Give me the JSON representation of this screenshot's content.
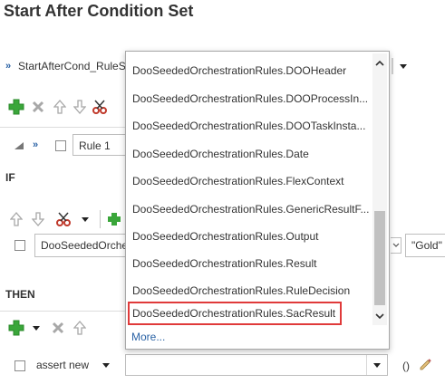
{
  "page": {
    "title": "Start After Condition Set"
  },
  "rule_set": {
    "name": "StartAfterCond_RuleS"
  },
  "rule": {
    "label": "Rule 1"
  },
  "sections": {
    "if_label": "IF",
    "then_label": "THEN"
  },
  "condition": {
    "left_value": "DooSeededOrche",
    "right_value": "\"Gold\""
  },
  "action": {
    "label": "assert new",
    "parens": "()"
  },
  "dropdown": {
    "options": [
      "DooSeededOrchestrationRules.DOOHeader",
      "DooSeededOrchestrationRules.DOOProcessIn...",
      "DooSeededOrchestrationRules.DOOTaskInsta...",
      "DooSeededOrchestrationRules.Date",
      "DooSeededOrchestrationRules.FlexContext",
      "DooSeededOrchestrationRules.GenericResultF...",
      "DooSeededOrchestrationRules.Output",
      "DooSeededOrchestrationRules.Result",
      "DooSeededOrchestrationRules.RuleDecision",
      "DooSeededOrchestrationRules.SacResult"
    ],
    "selected_index": 9,
    "more_label": "More..."
  },
  "colors": {
    "accent_blue": "#2a62a5",
    "add_green": "#3aa63a",
    "highlight_red": "#e03a3a",
    "cut_red": "#c0392b"
  },
  "icons": [
    "add-icon",
    "delete-icon",
    "move-up-icon",
    "move-down-icon",
    "cut-icon",
    "expand-icon",
    "collapse-icon",
    "chevron-down-icon",
    "dropdown-arrow-icon",
    "edit-icon"
  ]
}
